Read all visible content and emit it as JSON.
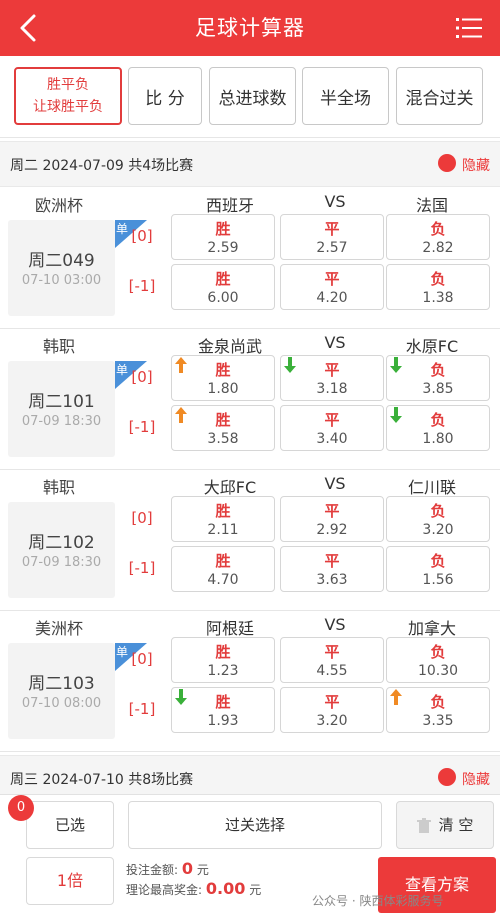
{
  "header": {
    "title": "足球计算器",
    "back_icon": "back-chevron-icon",
    "menu_icon": "list-menu-icon"
  },
  "tabs": [
    {
      "line1": "胜平负",
      "line2": "让球胜平负",
      "active": true
    },
    {
      "label": "比 分"
    },
    {
      "label": "总进球数"
    },
    {
      "label": "半全场"
    },
    {
      "label": "混合过关"
    }
  ],
  "days": [
    {
      "text": "周二 2024-07-09 共4场比赛",
      "hide": "隐藏"
    },
    {
      "text": "周三 2024-07-10 共8场比赛",
      "hide": "隐藏"
    }
  ],
  "matches": [
    {
      "league": "欧洲杯",
      "home": "西班牙",
      "vs": "VS",
      "away": "法国",
      "id": "周二049",
      "time": "07-10 03:00",
      "single": "单",
      "rows": [
        {
          "handicap": "[0]",
          "cells": [
            {
              "label": "胜",
              "odds": "2.59",
              "arrow": ""
            },
            {
              "label": "平",
              "odds": "2.57",
              "arrow": ""
            },
            {
              "label": "负",
              "odds": "2.82",
              "arrow": ""
            }
          ]
        },
        {
          "handicap": "[-1]",
          "cells": [
            {
              "label": "胜",
              "odds": "6.00",
              "arrow": ""
            },
            {
              "label": "平",
              "odds": "4.20",
              "arrow": ""
            },
            {
              "label": "负",
              "odds": "1.38",
              "arrow": ""
            }
          ]
        }
      ]
    },
    {
      "league": "韩职",
      "home": "金泉尚武",
      "vs": "VS",
      "away": "水原FC",
      "id": "周二101",
      "time": "07-09 18:30",
      "single": "单",
      "rows": [
        {
          "handicap": "[0]",
          "cells": [
            {
              "label": "胜",
              "odds": "1.80",
              "arrow": "up"
            },
            {
              "label": "平",
              "odds": "3.18",
              "arrow": "down"
            },
            {
              "label": "负",
              "odds": "3.85",
              "arrow": "down"
            }
          ]
        },
        {
          "handicap": "[-1]",
          "cells": [
            {
              "label": "胜",
              "odds": "3.58",
              "arrow": "up"
            },
            {
              "label": "平",
              "odds": "3.40",
              "arrow": ""
            },
            {
              "label": "负",
              "odds": "1.80",
              "arrow": "down"
            }
          ]
        }
      ]
    },
    {
      "league": "韩职",
      "home": "大邱FC",
      "vs": "VS",
      "away": "仁川联",
      "id": "周二102",
      "time": "07-09 18:30",
      "single": "",
      "rows": [
        {
          "handicap": "[0]",
          "cells": [
            {
              "label": "胜",
              "odds": "2.11",
              "arrow": ""
            },
            {
              "label": "平",
              "odds": "2.92",
              "arrow": ""
            },
            {
              "label": "负",
              "odds": "3.20",
              "arrow": ""
            }
          ]
        },
        {
          "handicap": "[-1]",
          "cells": [
            {
              "label": "胜",
              "odds": "4.70",
              "arrow": ""
            },
            {
              "label": "平",
              "odds": "3.63",
              "arrow": ""
            },
            {
              "label": "负",
              "odds": "1.56",
              "arrow": ""
            }
          ]
        }
      ]
    },
    {
      "league": "美洲杯",
      "home": "阿根廷",
      "vs": "VS",
      "away": "加拿大",
      "id": "周二103",
      "time": "07-10 08:00",
      "single": "单",
      "rows": [
        {
          "handicap": "[0]",
          "cells": [
            {
              "label": "胜",
              "odds": "1.23",
              "arrow": ""
            },
            {
              "label": "平",
              "odds": "4.55",
              "arrow": ""
            },
            {
              "label": "负",
              "odds": "10.30",
              "arrow": ""
            }
          ]
        },
        {
          "handicap": "[-1]",
          "cells": [
            {
              "label": "胜",
              "odds": "1.93",
              "arrow": "down"
            },
            {
              "label": "平",
              "odds": "3.20",
              "arrow": ""
            },
            {
              "label": "负",
              "odds": "3.35",
              "arrow": "up"
            }
          ]
        }
      ]
    }
  ],
  "footer": {
    "selected_count": "0",
    "selected_label": "已选",
    "pass_label": "过关选择",
    "clear_label": "清 空",
    "multiple": "1倍",
    "bet_label": "投注金额:",
    "bet_value": "0",
    "bet_unit": "元",
    "max_label": "理论最高奖金:",
    "max_value": "0.00",
    "max_unit": "元",
    "submit_label": "查看方案",
    "watermark": "公众号 · 陕西体彩服务号"
  },
  "colors": {
    "accent": "#ec3a3a",
    "up_arrow": "#f08a24",
    "down_arrow": "#3ab03a",
    "single_tag": "#4a90d9"
  }
}
